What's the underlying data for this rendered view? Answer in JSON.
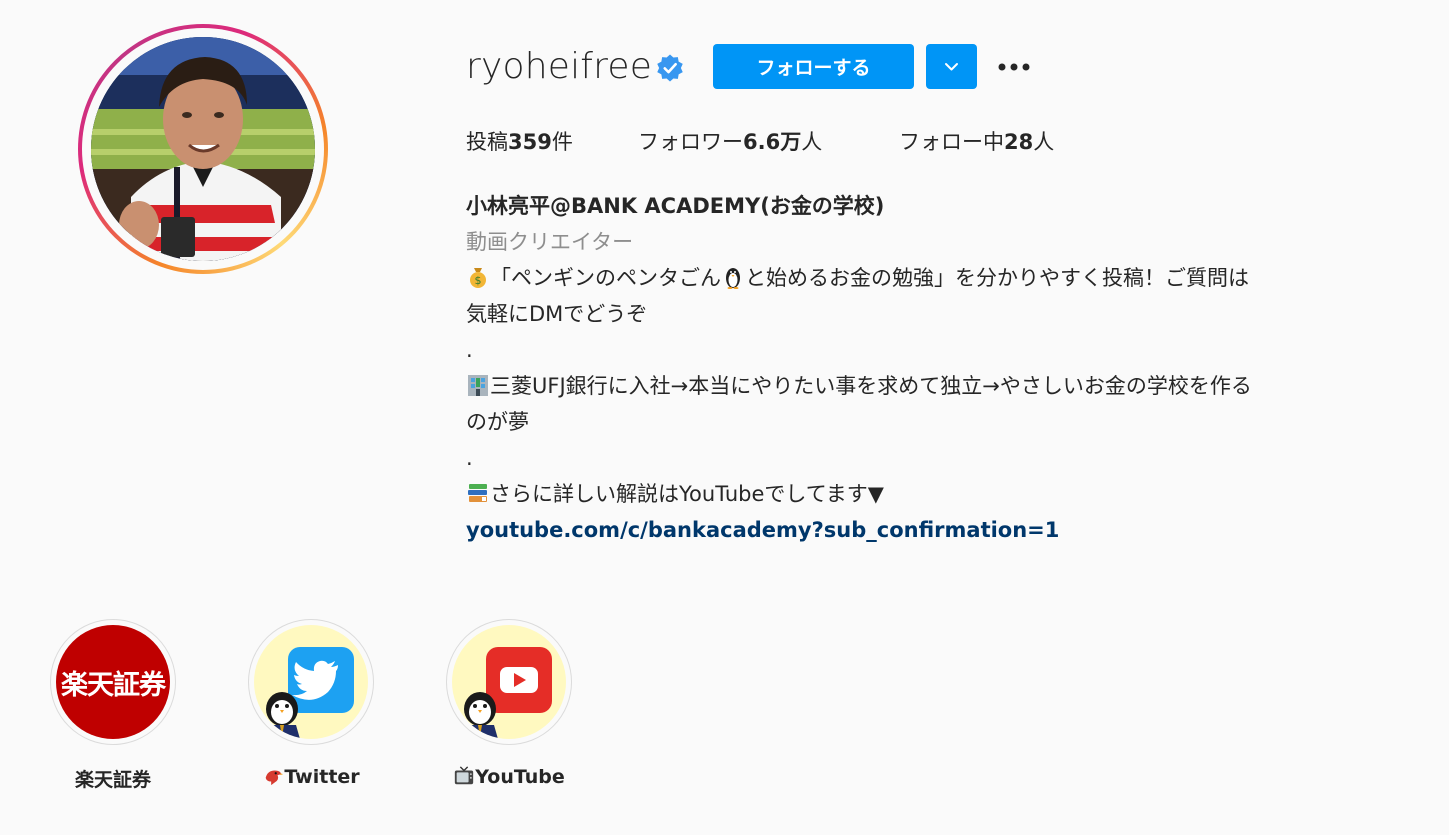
{
  "profile": {
    "username": "ryoheifree",
    "follow_label": "フォローする",
    "stats": {
      "posts_prefix": "投稿",
      "posts_value": "359",
      "posts_suffix": "件",
      "followers_prefix": "フォロワー",
      "followers_value": "6.6万",
      "followers_suffix": "人",
      "following_prefix": "フォロー中",
      "following_value": "28",
      "following_suffix": "人"
    },
    "bio": {
      "name": "小林亮平@BANK ACADEMY(お金の学校)",
      "category": "動画クリエイター",
      "line1": "「ペンギンのペンタごん",
      "line1b": "と始めるお金の勉強」を分かりやすく投稿！ご質問は",
      "line2": "気軽にDMでどうぞ",
      "dot1": ".",
      "line3": "三菱UFJ銀行に入社→本当にやりたい事を求めて独立→やさしいお金の学校を作る",
      "line4": "のが夢",
      "dot2": ".",
      "line5": "さらに詳しい解説はYouTubeでしてます▼",
      "link": "youtube.com/c/bankacademy?sub_confirmation=1"
    }
  },
  "highlights": [
    {
      "label": "楽天証券",
      "badge_text": "楽天証券",
      "icon": "rakuten-badge"
    },
    {
      "label": "Twitter",
      "icon": "twitter-icon"
    },
    {
      "label": "YouTube",
      "icon": "youtube-icon"
    }
  ],
  "colors": {
    "accent": "#0095f6",
    "link": "#00376b",
    "muted": "#8e8e8e",
    "verified": "#3897f0",
    "rakuten": "#bf0000",
    "twitter": "#1da1f2",
    "youtube": "#e52d27",
    "highlight_bg": "#fff9c0"
  }
}
